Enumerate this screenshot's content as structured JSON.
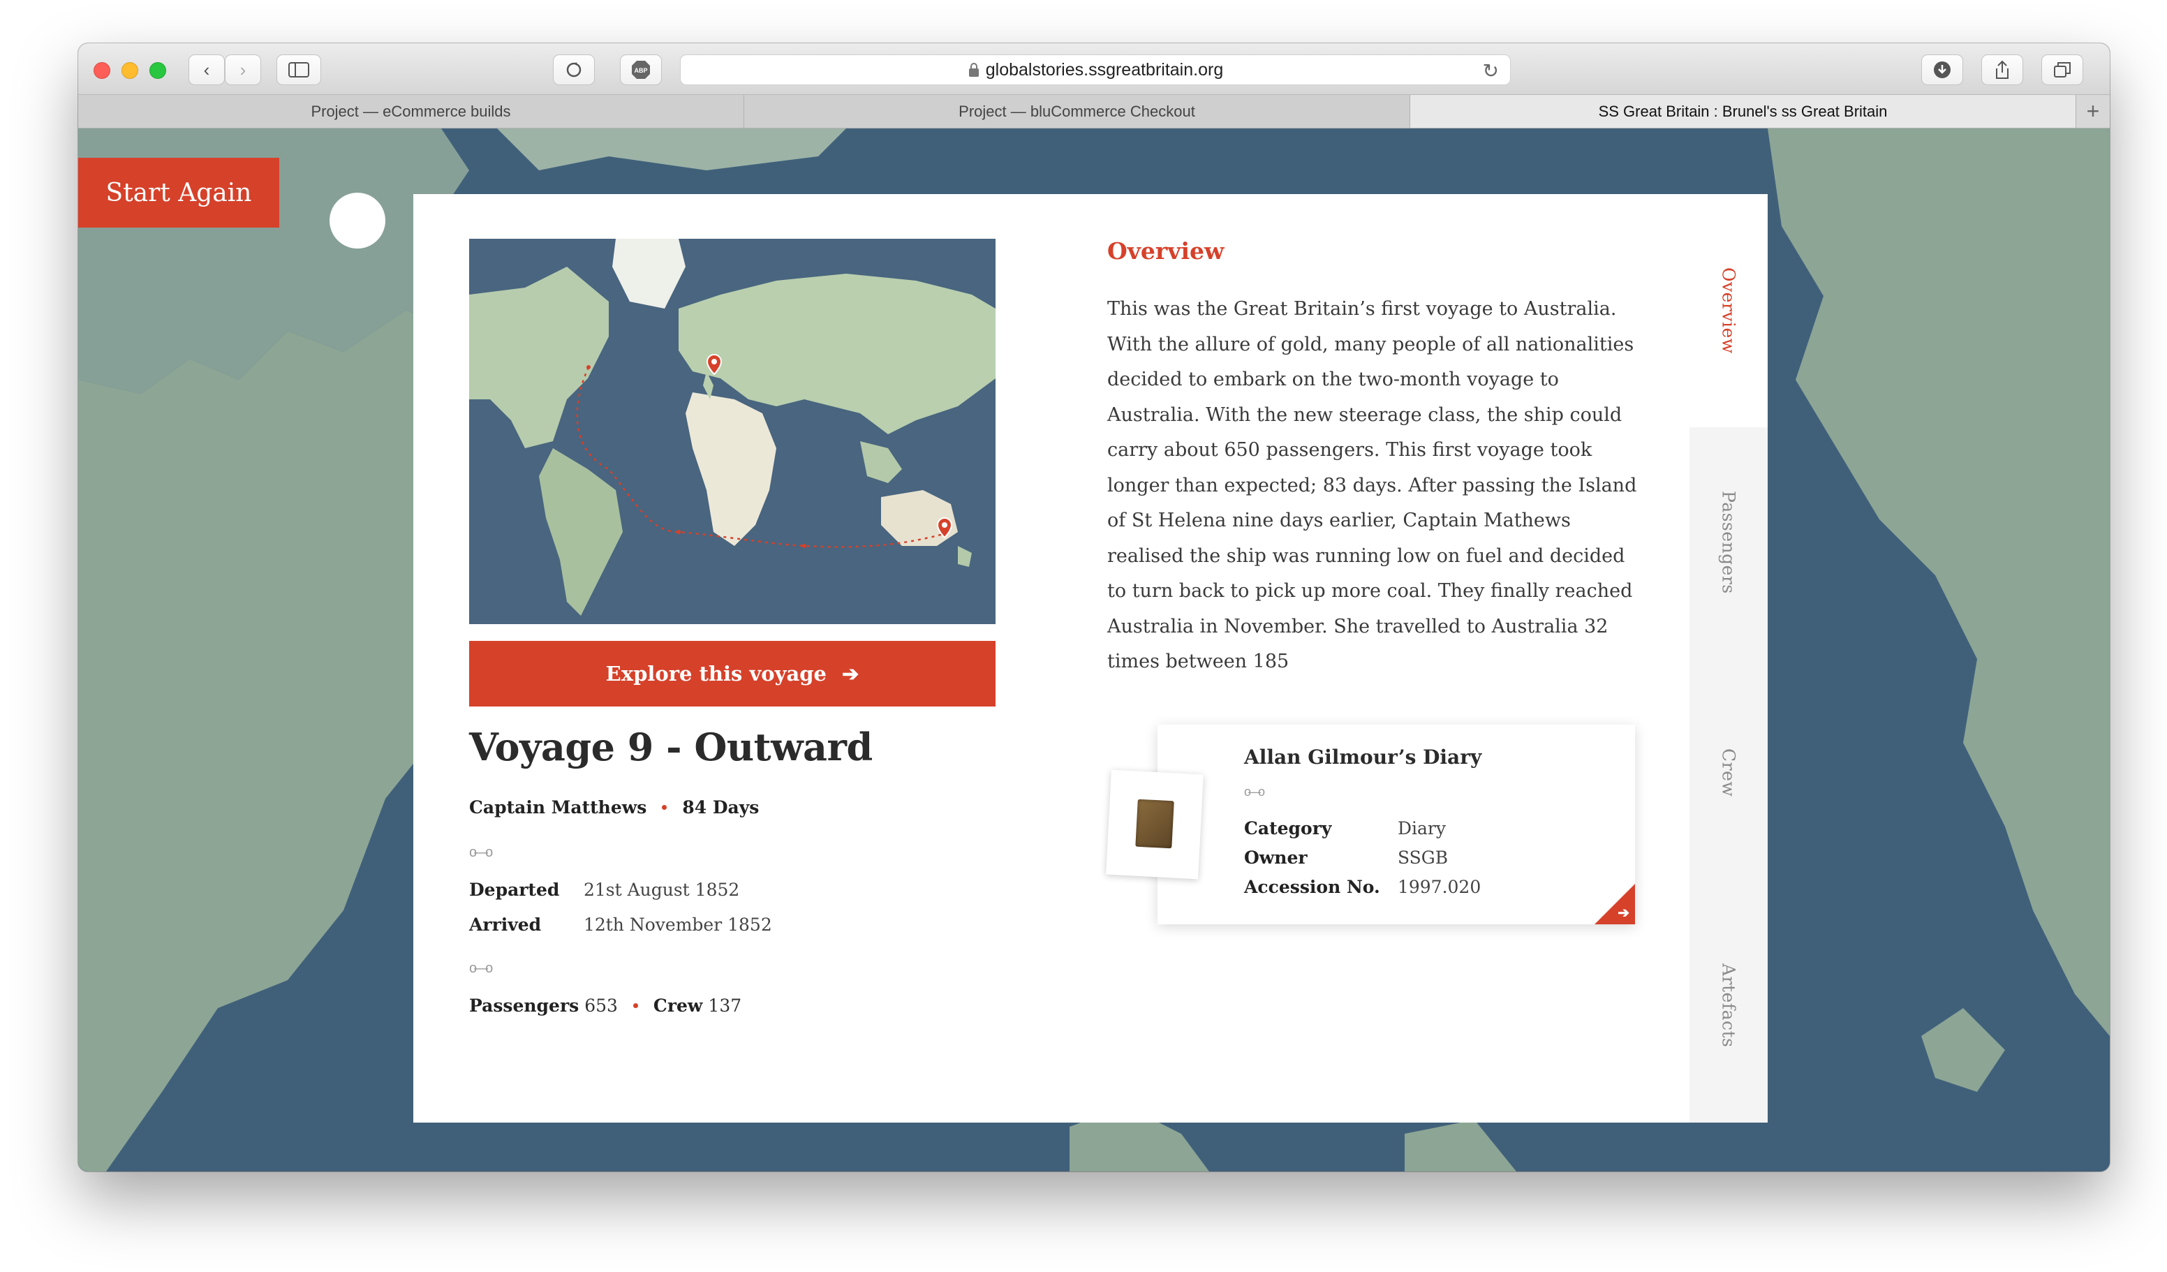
{
  "browser": {
    "url": "globalstories.ssgreatbritain.org",
    "tabs": [
      {
        "label": "Project — eCommerce builds"
      },
      {
        "label": "Project — bluCommerce Checkout"
      },
      {
        "label": "SS Great Britain : Brunel's ss Great Britain"
      }
    ],
    "add_tab": "+"
  },
  "page": {
    "start_again": "Start Again",
    "explore_button": "Explore this voyage",
    "voyage_title": "Voyage 9 - Outward",
    "captain": "Captain Matthews",
    "duration": "84 Days",
    "departed_label": "Departed",
    "departed_value": "21st August 1852",
    "arrived_label": "Arrived",
    "arrived_value": "12th November 1852",
    "passengers_label": "Passengers",
    "passengers_value": "653",
    "crew_label": "Crew",
    "crew_value": "137",
    "overview_heading": "Overview",
    "overview_text": "This was the Great Britain’s first voyage to Australia. With the allure of gold, many people of all nationalities decided to embark on the two-month voyage to Australia. With the new steerage class, the ship could carry about 650 passengers.   This first voyage took longer than expected; 83 days. After passing the Island of St Helena nine days earlier, Captain Mathews realised the ship was running low on fuel and decided to turn back to pick up more coal. They finally reached Australia in November. She travelled to Australia 32 times between 185"
  },
  "artefact": {
    "title": "Allan Gilmour’s Diary",
    "category_label": "Category",
    "category_value": "Diary",
    "owner_label": "Owner",
    "owner_value": "SSGB",
    "accession_label": "Accession No.",
    "accession_value": "1997.020"
  },
  "side_tabs": [
    {
      "label": "Overview",
      "active": true
    },
    {
      "label": "Passengers",
      "active": false
    },
    {
      "label": "Crew",
      "active": false
    },
    {
      "label": "Artefacts",
      "active": false
    }
  ],
  "colors": {
    "accent": "#d6412a",
    "ocean": "#41607b",
    "land": "#8fa896"
  }
}
